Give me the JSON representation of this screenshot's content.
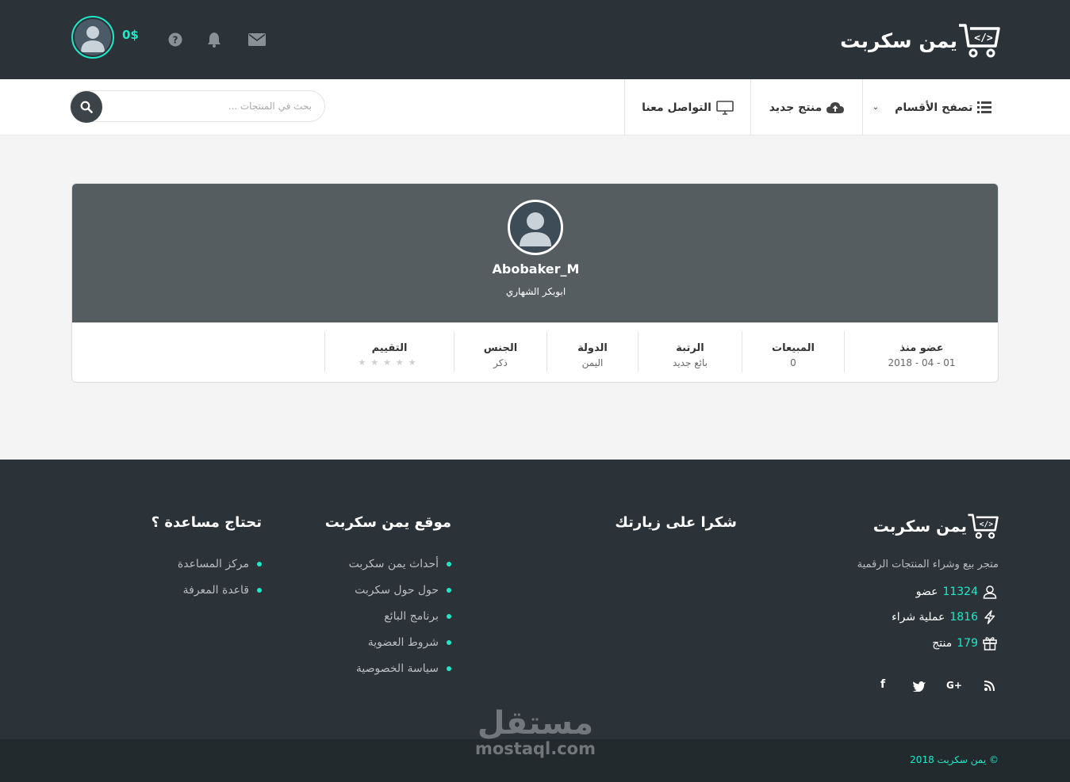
{
  "brand": {
    "logo_text": "يمن سكربت",
    "accent": "#1de9c8",
    "dark": "#2c3338"
  },
  "topbar": {
    "balance": "0$",
    "icons": [
      "avatar-icon",
      "help-icon",
      "bell-icon",
      "envelope-icon"
    ]
  },
  "nav": {
    "browse": {
      "label": "تصفح الأقسام",
      "icon": "list-icon"
    },
    "new_product": {
      "label": "منتج جديد",
      "icon": "cloud-upload-icon"
    },
    "contact": {
      "label": "التواصل معنا",
      "icon": "monitor-icon"
    },
    "search_placeholder": "بحث في المنتجات ..."
  },
  "profile": {
    "username": "Abobaker_M",
    "full_name": "ابوبكر الشهاري",
    "stats": [
      {
        "label": "عضو منذ",
        "value": "2018 - 04 - 01"
      },
      {
        "label": "المبيعات",
        "value": "0"
      },
      {
        "label": "الرتبة",
        "value": "بائع جديد"
      },
      {
        "label": "الدولة",
        "value": "اليمن"
      },
      {
        "label": "الجنس",
        "value": "ذكر"
      },
      {
        "label": "التقييم",
        "value": "★★★★★",
        "rating": 0,
        "max": 5
      }
    ]
  },
  "footer": {
    "tagline": "متجر بيع وشراء المنتجات الرقمية",
    "stats": [
      {
        "num": "11324",
        "label": "عضو",
        "icon": "user-icon"
      },
      {
        "num": "1816",
        "label": "عملية شراء",
        "icon": "bolt-icon"
      },
      {
        "num": "179",
        "label": "منتج",
        "icon": "gift-icon"
      }
    ],
    "thanks_title": "شكرا على زيارتك",
    "site_title": "موقع يمن سكربت",
    "site_links": [
      "أحداث يمن سكربت",
      "حول حول سكربت",
      "برنامج البائع",
      "شروط العضوية",
      "سياسة الخصوصية"
    ],
    "help_title": "تحتاج مساعدة ؟",
    "help_links": [
      "مركز المساعدة",
      "قاعدة المعرفة"
    ],
    "social": [
      {
        "icon": "facebook-icon",
        "glyph": "f"
      },
      {
        "icon": "twitter-icon",
        "glyph": "🐦"
      },
      {
        "icon": "google-plus-icon",
        "glyph": "G+"
      },
      {
        "icon": "rss-icon",
        "glyph": "rss"
      }
    ],
    "copyright": "© يمن سكربت 2018"
  },
  "watermark": {
    "arabic": "مستقل",
    "latin": "mostaql.com"
  }
}
